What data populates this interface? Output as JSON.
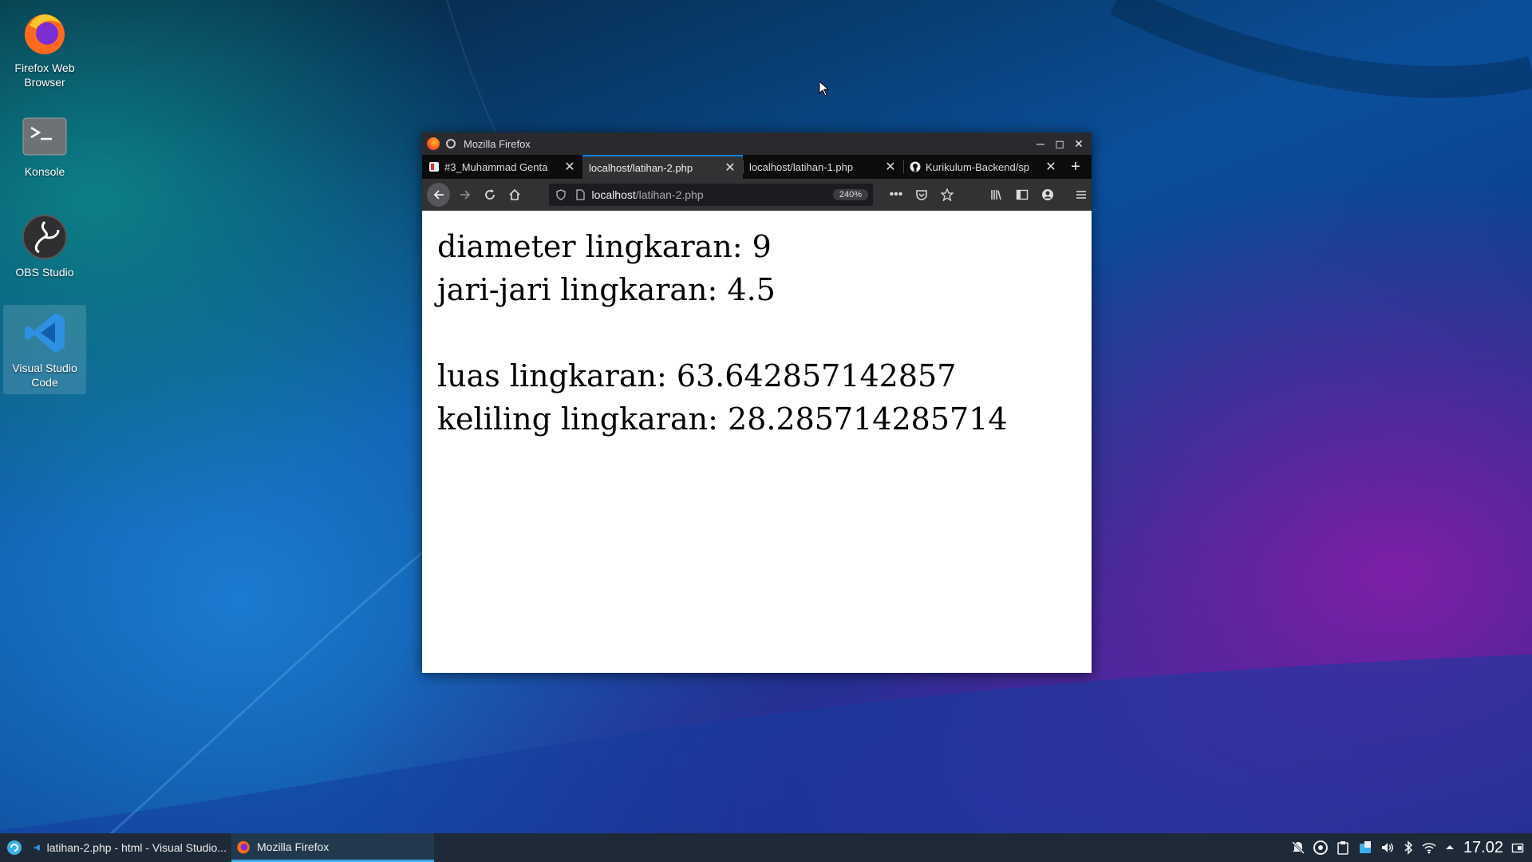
{
  "desktop": {
    "icons": [
      {
        "label": "Firefox Web Browser"
      },
      {
        "label": "Konsole"
      },
      {
        "label": "OBS Studio"
      },
      {
        "label": "Visual Studio Code"
      }
    ]
  },
  "window": {
    "title": "Mozilla Firefox",
    "tabs": [
      {
        "label": "#3_Muhammad Genta"
      },
      {
        "label": "localhost/latihan-2.php"
      },
      {
        "label": "localhost/latihan-1.php"
      },
      {
        "label": "Kurikulum-Backend/sp"
      }
    ],
    "url_host": "localhost",
    "url_path": "/latihan-2.php",
    "zoom": "240%"
  },
  "page": {
    "line1": "diameter lingkaran: 9",
    "line2": "jari-jari lingkaran: 4.5",
    "line3": "luas lingkaran: 63.642857142857",
    "line4": "keliling lingkaran: 28.285714285714"
  },
  "taskbar": {
    "tasks": [
      {
        "label": "latihan-2.php - html - Visual Studio..."
      },
      {
        "label": "Mozilla Firefox"
      }
    ],
    "clock": "17.02"
  }
}
